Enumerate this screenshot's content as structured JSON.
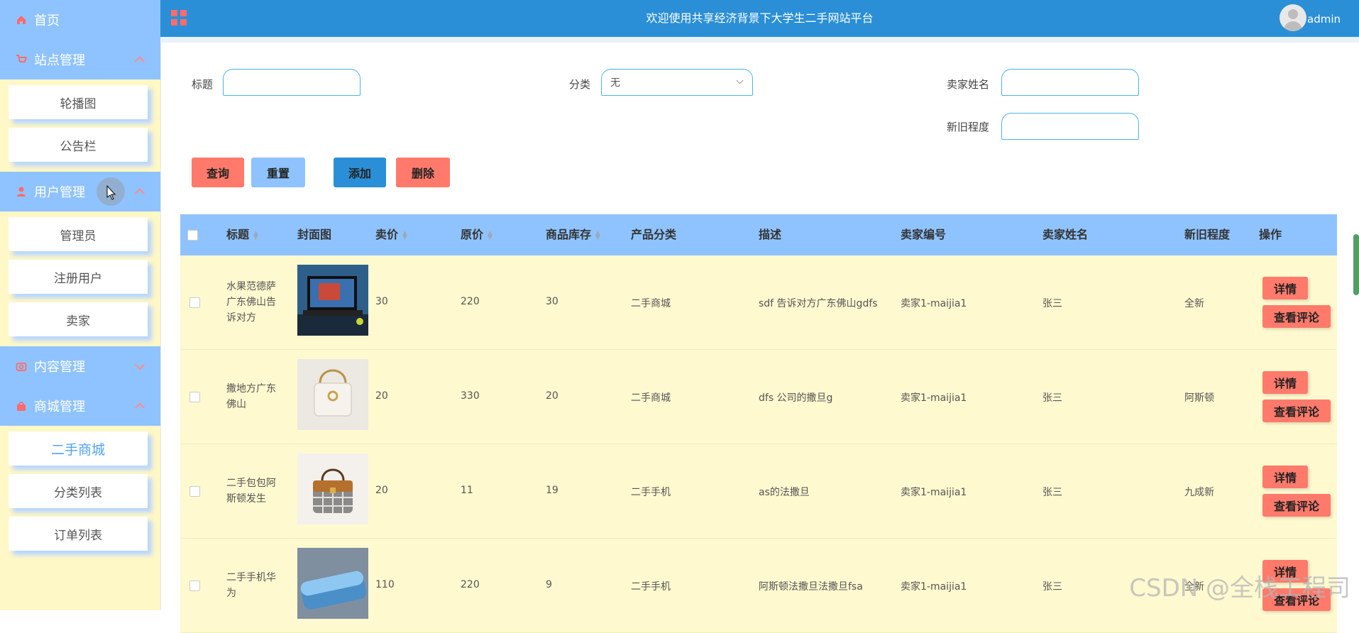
{
  "header": {
    "title": "欢迎使用共享经济背景下大学生二手网站平台",
    "user": "admin"
  },
  "sidebar": {
    "home": "首页",
    "groups": [
      {
        "label": "站点管理",
        "items": [
          "轮播图",
          "公告栏"
        ]
      },
      {
        "label": "用户管理",
        "items": [
          "管理员",
          "注册用户",
          "卖家"
        ]
      },
      {
        "label": "内容管理",
        "items": []
      },
      {
        "label": "商城管理",
        "items": [
          "二手商城",
          "分类列表",
          "订单列表"
        ]
      }
    ]
  },
  "search": {
    "title_label": "标题",
    "category_label": "分类",
    "category_value": "无",
    "seller_name_label": "卖家姓名",
    "condition_label": "新旧程度"
  },
  "actions": {
    "query": "查询",
    "reset": "重置",
    "add": "添加",
    "delete": "删除"
  },
  "table": {
    "headers": [
      "标题",
      "封面图",
      "卖价",
      "原价",
      "商品库存",
      "产品分类",
      "描述",
      "卖家编号",
      "卖家姓名",
      "新旧程度",
      "操作"
    ],
    "rows": [
      {
        "title": "水果范德萨广东佛山告诉对方",
        "price": "30",
        "original": "220",
        "stock": "30",
        "category": "二手商城",
        "desc": "sdf 告诉对方广东佛山gdfs",
        "seller_no": "卖家1-maijia1",
        "seller_name": "张三",
        "condition": "全新"
      },
      {
        "title": "撒地方广东佛山",
        "price": "20",
        "original": "330",
        "stock": "20",
        "category": "二手商城",
        "desc": "dfs 公司的撒旦g",
        "seller_no": "卖家1-maijia1",
        "seller_name": "张三",
        "condition": "阿斯顿"
      },
      {
        "title": "二手包包阿斯顿发生",
        "price": "20",
        "original": "11",
        "stock": "19",
        "category": "二手手机",
        "desc": "as的法撒旦",
        "seller_no": "卖家1-maijia1",
        "seller_name": "张三",
        "condition": "九成新"
      },
      {
        "title": "二手手机华为",
        "price": "110",
        "original": "220",
        "stock": "9",
        "category": "二手手机",
        "desc": "阿斯顿法撒旦法撒旦fsa",
        "seller_no": "卖家1-maijia1",
        "seller_name": "张三",
        "condition": "全新"
      }
    ],
    "detail_label": "详情",
    "review_label": "查看评论"
  },
  "watermark": "CSDN @全栈工程司"
}
